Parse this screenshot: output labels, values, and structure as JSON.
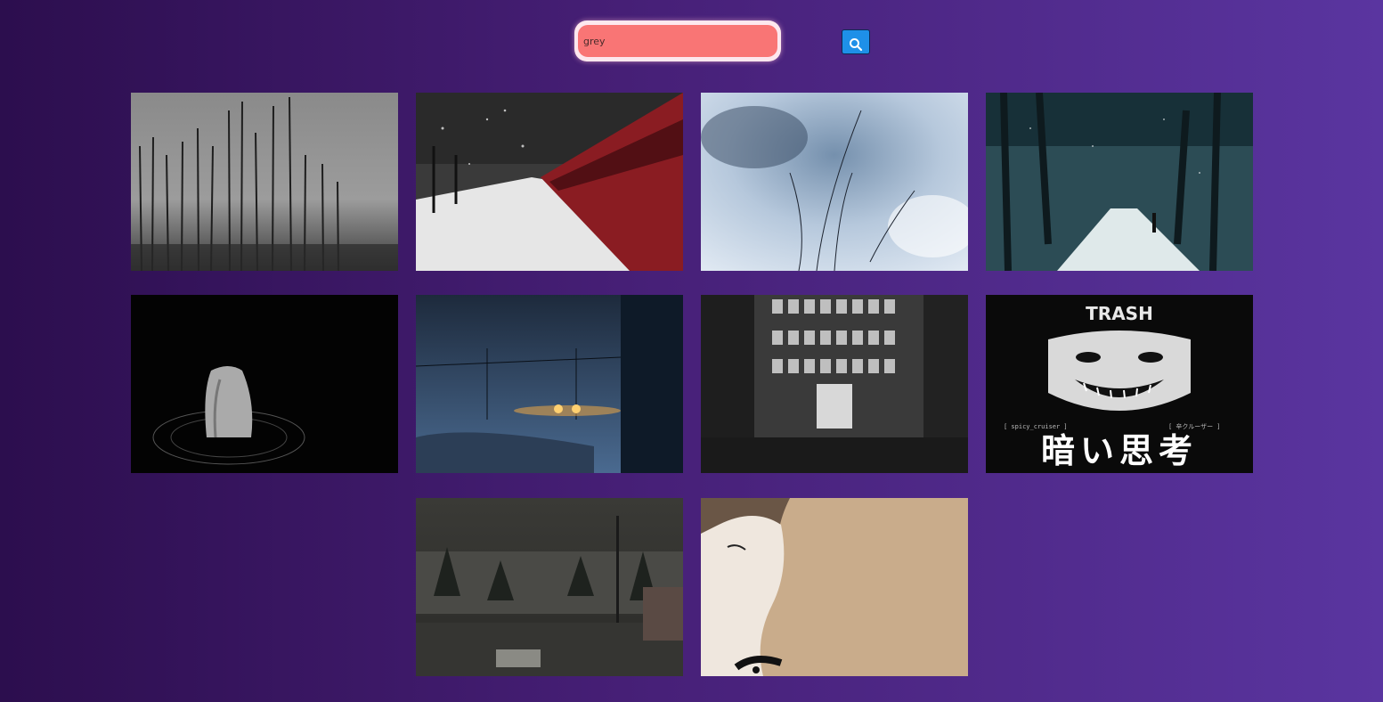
{
  "search": {
    "value": "grey",
    "button_icon": "search-icon"
  },
  "gallery": {
    "images": [
      {
        "subject": "bare-forest-fog"
      },
      {
        "subject": "red-train-snow"
      },
      {
        "subject": "frosted-plants"
      },
      {
        "subject": "snowy-tree-avenue"
      },
      {
        "subject": "stone-in-water"
      },
      {
        "subject": "night-train-snow"
      },
      {
        "subject": "lantern-street"
      },
      {
        "subject": "manga-smile-art"
      },
      {
        "subject": "rainy-parking-lot"
      },
      {
        "subject": "woman-profile"
      }
    ],
    "art_text": {
      "title_glyphs": "暗い思考",
      "left_tag": "[ spicy_cruiser ]",
      "right_tag": "[ 辛クルーザー ]",
      "logo": "TRASH"
    }
  }
}
